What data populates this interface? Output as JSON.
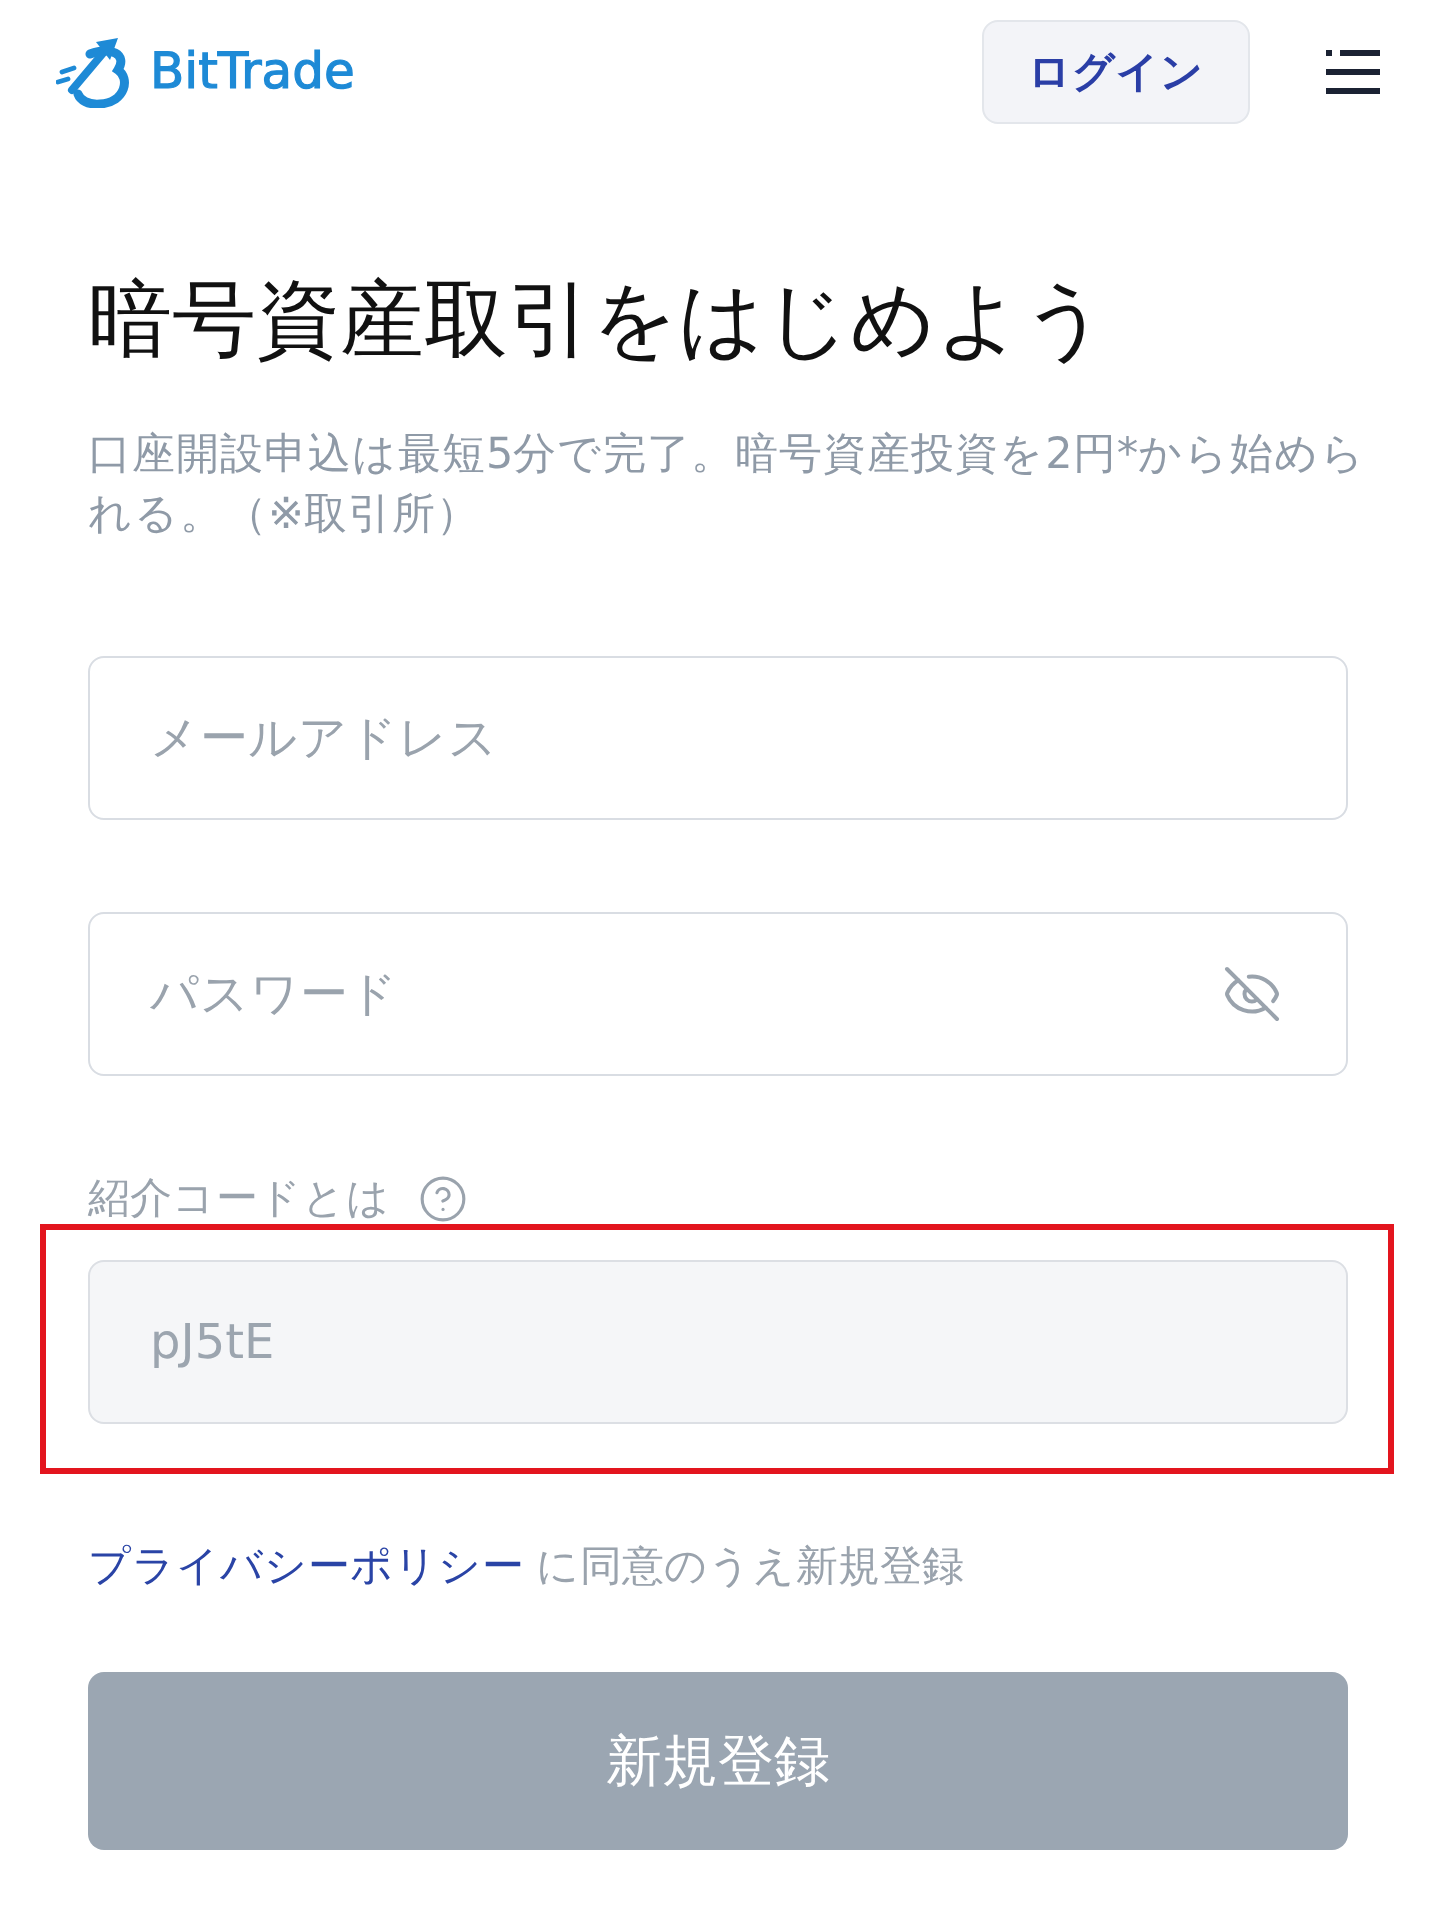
{
  "header": {
    "logo_text": "BitTrade",
    "login_button": "ログイン"
  },
  "title": "暗号資産取引をはじめよう",
  "intro": "口座開設申込は最短5分で完了。暗号資産投資を2円*から始められる。（※取引所）",
  "fields": [
    {
      "kind": "email",
      "placeholder": "メールアドレス"
    },
    {
      "kind": "password",
      "placeholder": "パスワード",
      "masked": true
    }
  ],
  "referral": {
    "label": "紹介コードとは",
    "value": "pJ5tE",
    "disabled": true,
    "highlighted": true
  },
  "consent": {
    "link": "プライバシーポリシー",
    "text": "に同意のうえ新規登録"
  },
  "submit": {
    "label": "新規登録",
    "disabled": true
  }
}
